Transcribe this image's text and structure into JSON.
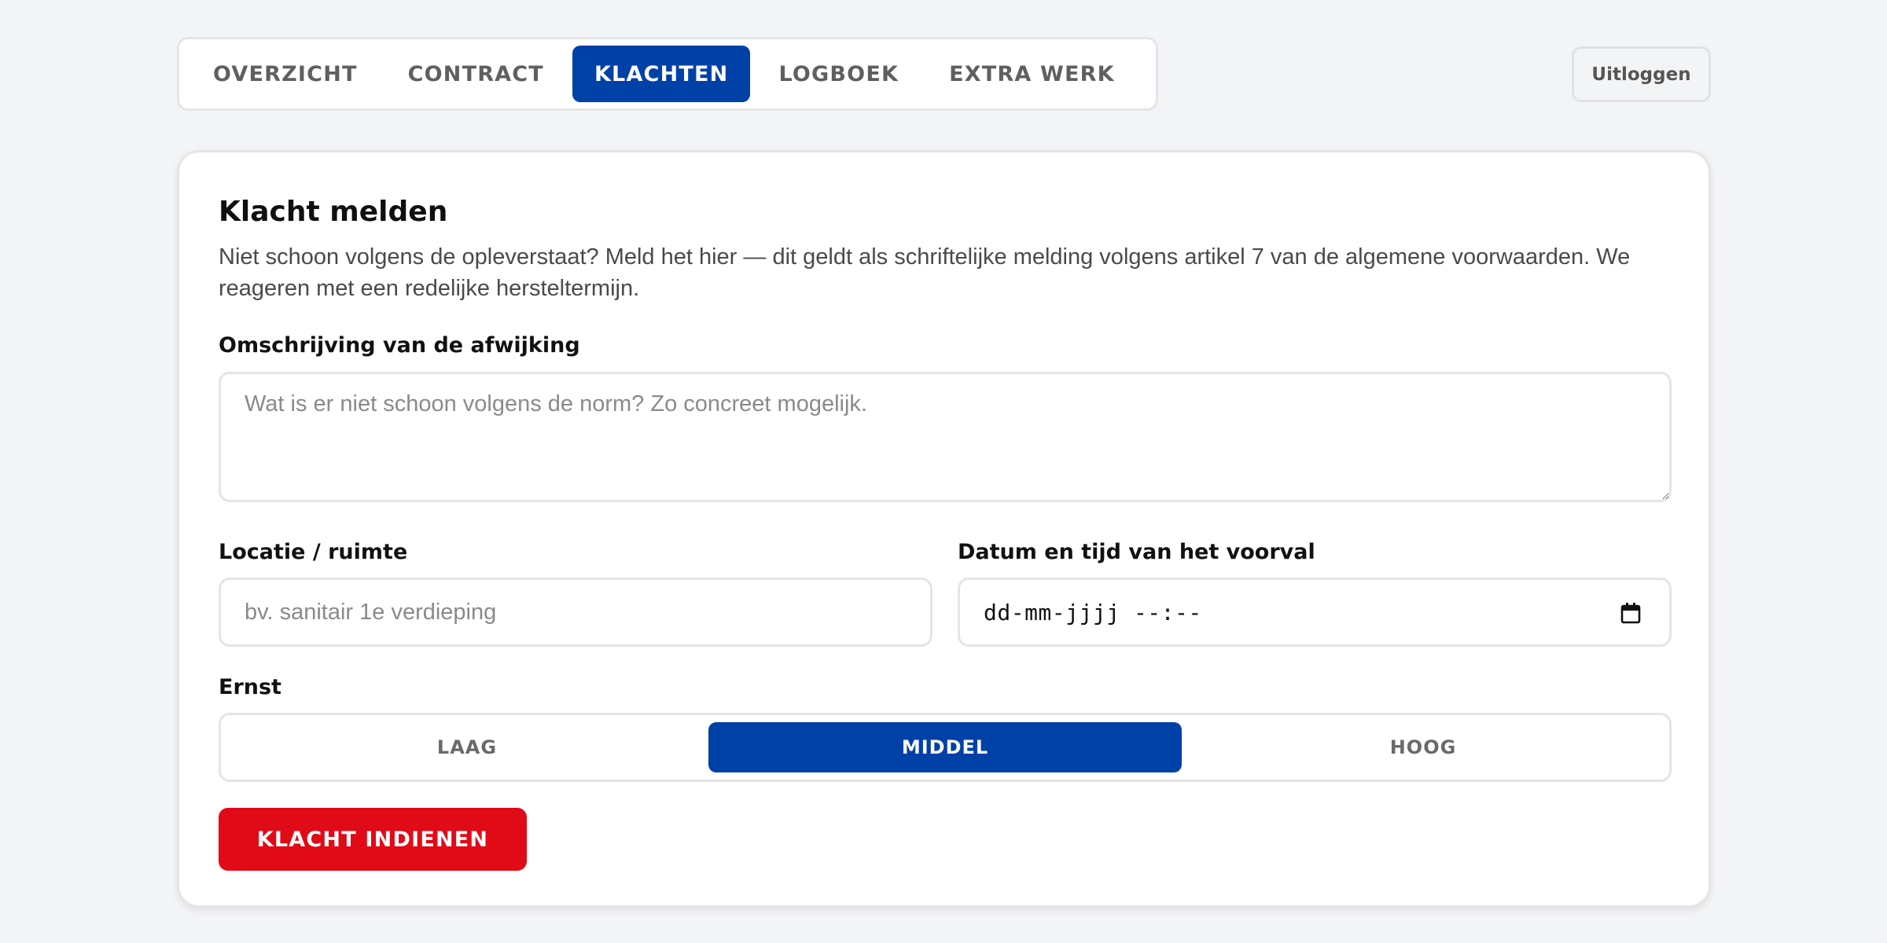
{
  "nav": {
    "tabs": [
      {
        "label": "OVERZICHT",
        "active": false
      },
      {
        "label": "CONTRACT",
        "active": false
      },
      {
        "label": "KLACHTEN",
        "active": true
      },
      {
        "label": "LOGBOEK",
        "active": false
      },
      {
        "label": "EXTRA WERK",
        "active": false
      }
    ],
    "logout_label": "Uitloggen"
  },
  "form": {
    "title": "Klacht melden",
    "description": "Niet schoon volgens de opleverstaat? Meld het hier — dit geldt als schriftelijke melding volgens artikel 7 van de algemene voorwaarden. We reageren met een redelijke hersteltermijn.",
    "description_label": "Omschrijving van de afwijking",
    "description_placeholder": "Wat is er niet schoon volgens de norm? Zo concreet mogelijk.",
    "location_label": "Locatie / ruimte",
    "location_placeholder": "bv. sanitair 1e verdieping",
    "datetime_label": "Datum en tijd van het voorval",
    "datetime_placeholder": "dd-mm-jjjj --:--",
    "severity_label": "Ernst",
    "severity_options": [
      {
        "label": "LAAG",
        "active": false
      },
      {
        "label": "MIDDEL",
        "active": true
      },
      {
        "label": "HOOG",
        "active": false
      }
    ],
    "submit_label": "KLACHT INDIENEN"
  },
  "colors": {
    "accent_blue": "#0041a8",
    "submit_red": "#e10a17",
    "background": "#f3f4f6"
  },
  "icons": {
    "datetime": "calendar-icon"
  }
}
